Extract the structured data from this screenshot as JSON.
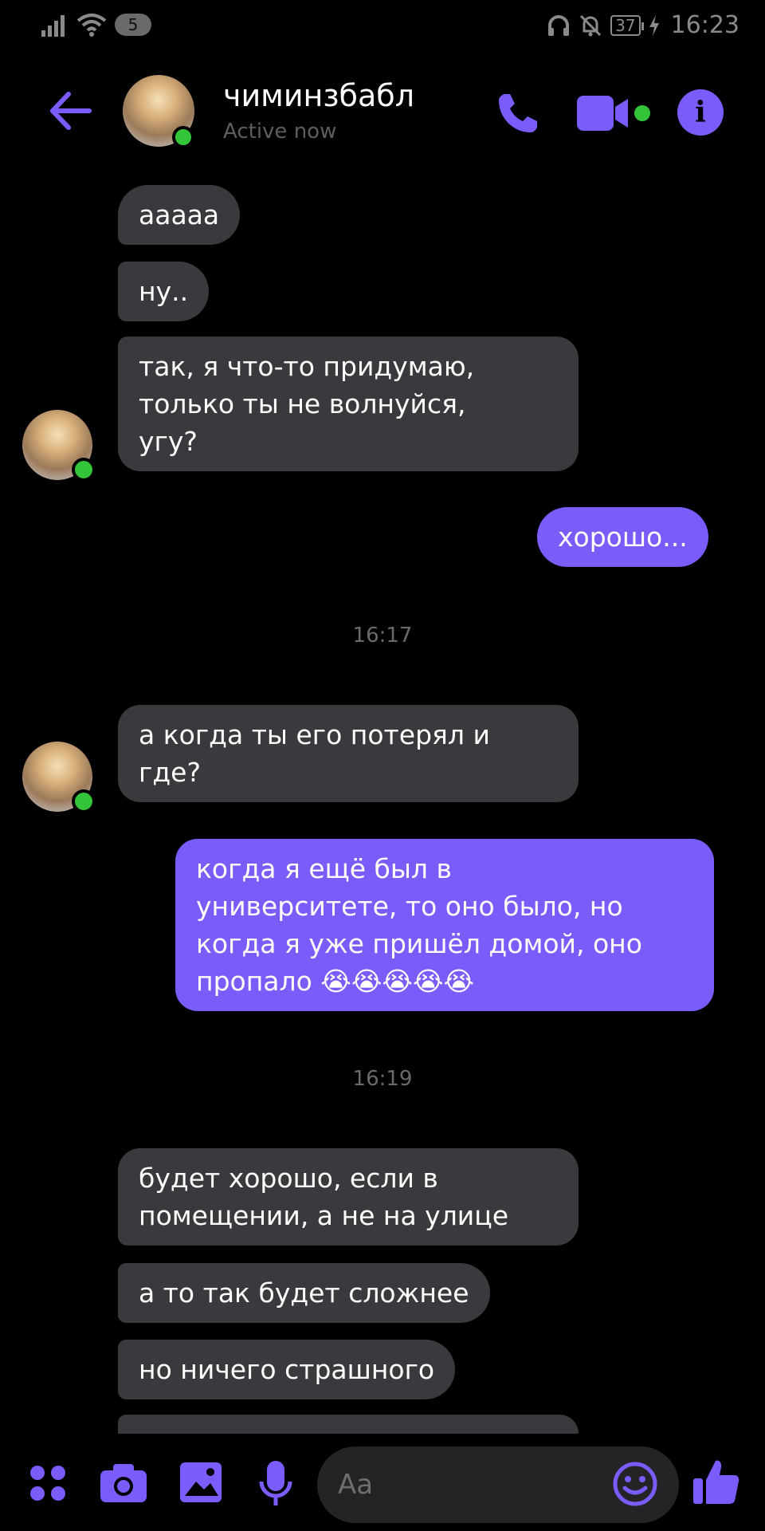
{
  "status_bar": {
    "sim_badge": "5",
    "battery": "37",
    "time": "16:23"
  },
  "header": {
    "contact_name": "чиминзбабл",
    "contact_status": "Active now",
    "icons": [
      "back-arrow-icon",
      "phone-icon",
      "video-camera-icon",
      "info-icon"
    ]
  },
  "messages": [
    {
      "side": "in",
      "text": "ааааа"
    },
    {
      "side": "in",
      "text": "ну.."
    },
    {
      "side": "in",
      "text": "так, я что-то придумаю,\nтолько ты не волнуйся,\nугу?"
    },
    {
      "side": "out",
      "text": "хорошо..."
    },
    {
      "timestamp": "16:17"
    },
    {
      "side": "in",
      "text": "а когда ты его потерял и\nгде?"
    },
    {
      "side": "out",
      "text": "когда я ещё был в\nуниверситете, то оно было, но\nкогда я уже пришёл домой, оно\nпропало 😭😭😭😭😭"
    },
    {
      "timestamp": "16:19"
    },
    {
      "side": "in",
      "text": "будет хорошо, если в\nпомещении, а не на улице"
    },
    {
      "side": "in",
      "text": "а то так будет сложнее"
    },
    {
      "side": "in",
      "text": "но ничего страшного"
    }
  ],
  "composer": {
    "placeholder": "Aa",
    "icons": [
      "menu-dots-icon",
      "camera-icon",
      "gallery-icon",
      "microphone-icon",
      "emoji-icon",
      "thumbs-up-icon"
    ]
  },
  "colors": {
    "accent": "#7b5cfa",
    "incoming_bubble": "#3a393e",
    "online": "#34c43a",
    "background": "#000000"
  }
}
